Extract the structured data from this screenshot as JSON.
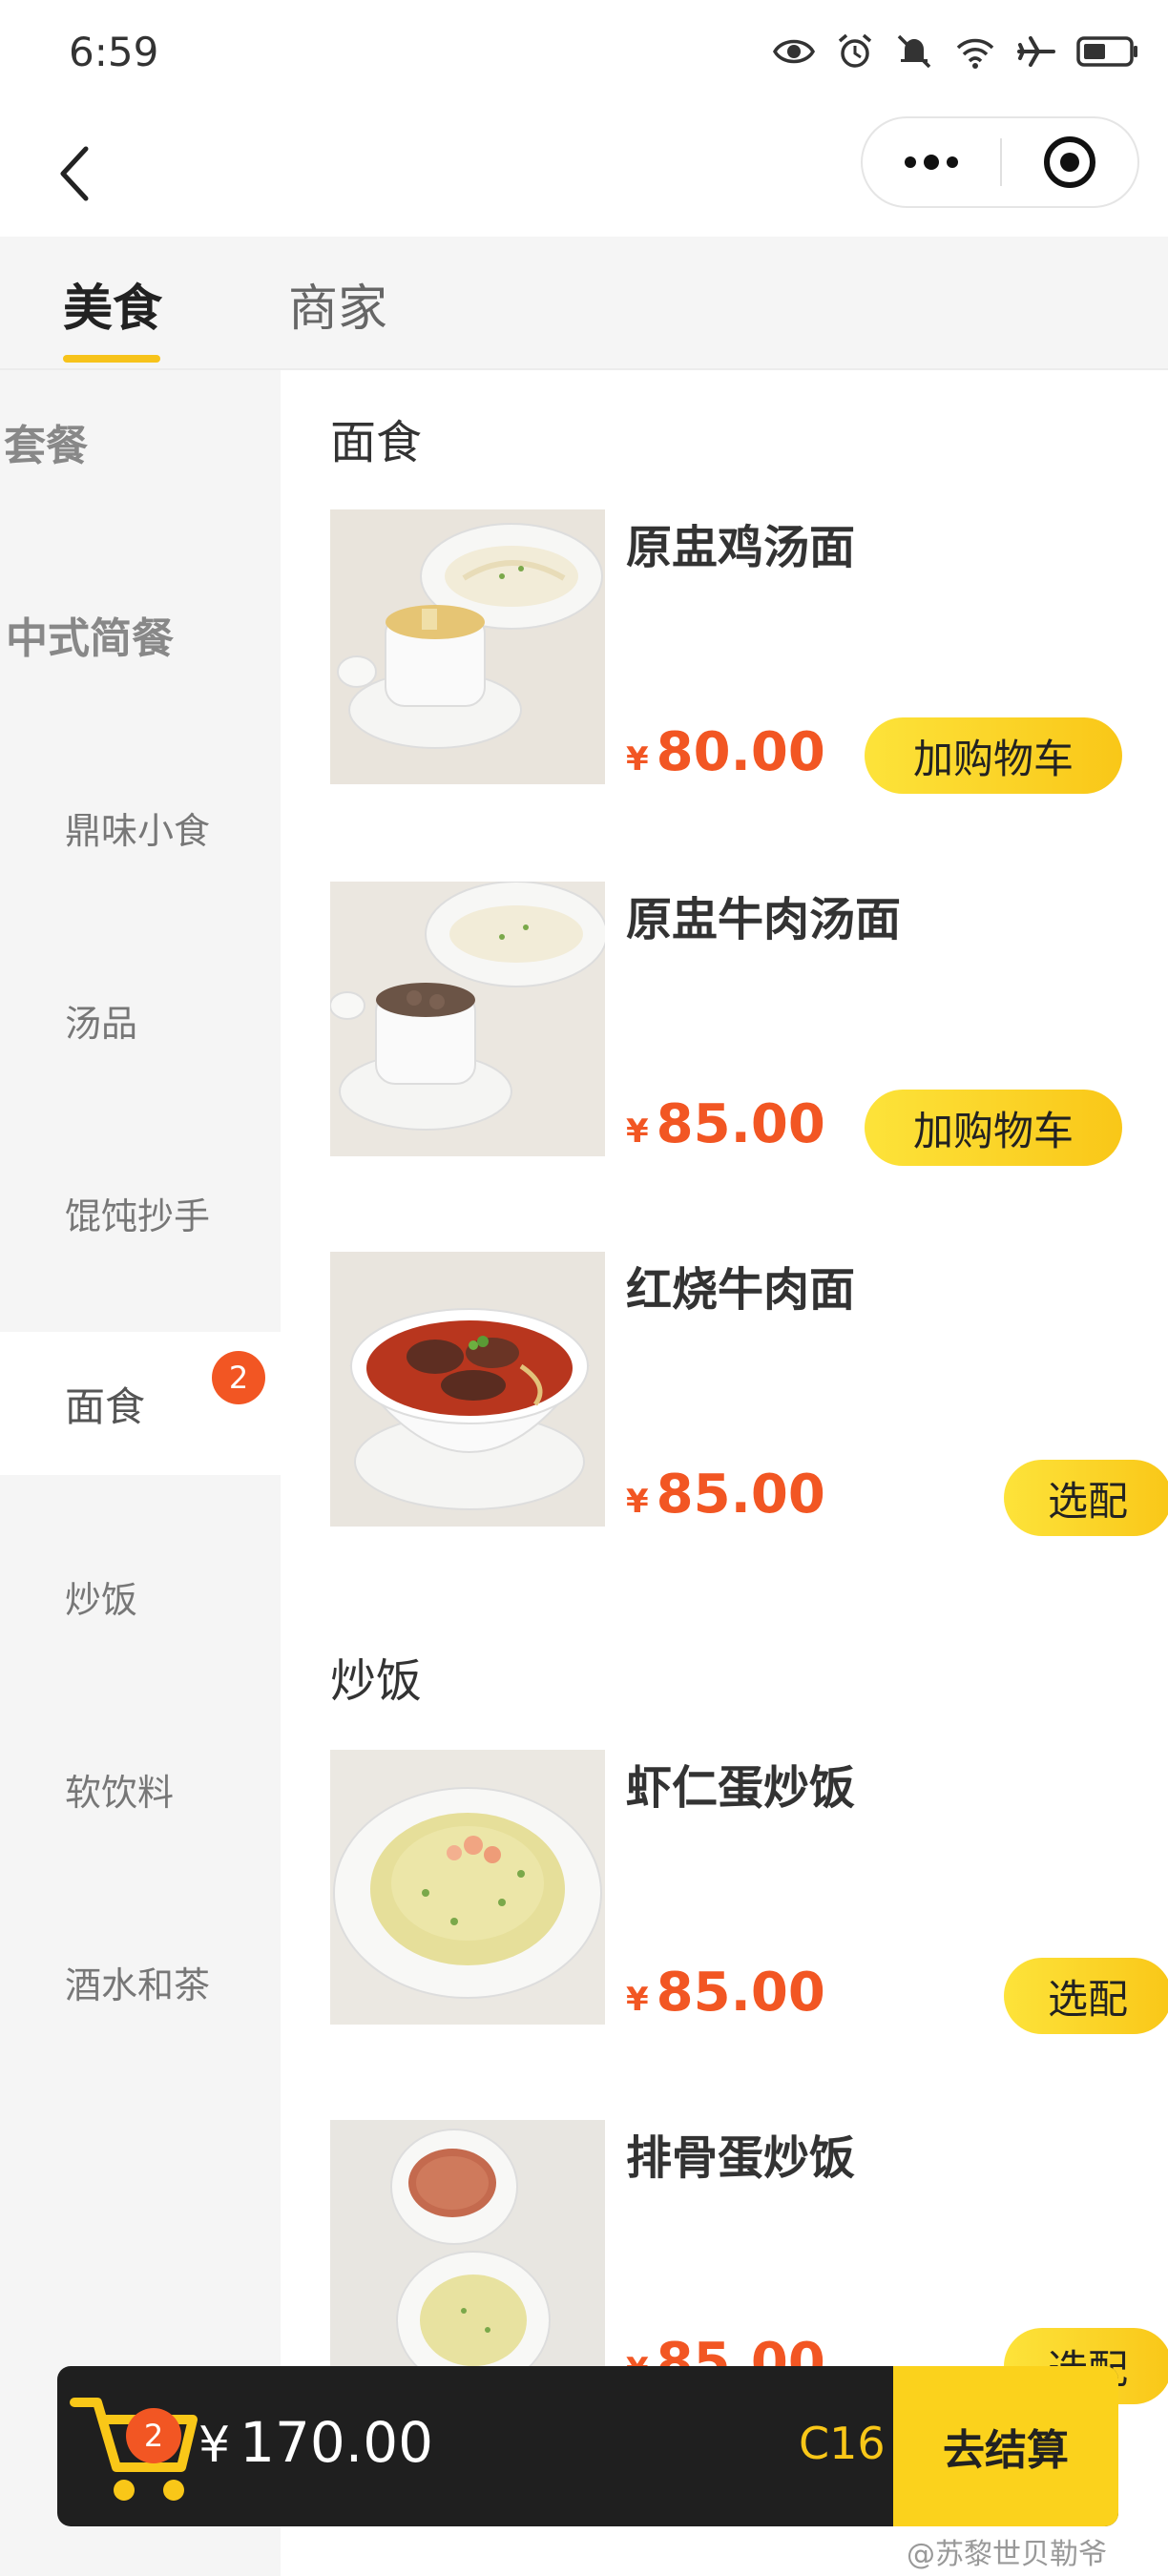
{
  "status_bar": {
    "time": "6:59",
    "icons": [
      "eye-icon",
      "alarm-icon",
      "bell-off-icon",
      "wifi-icon",
      "airplane-icon",
      "battery-icon"
    ]
  },
  "header": {
    "back_icon": "chevron-left-icon",
    "more_icon": "more-dots-icon",
    "close_icon": "target-icon"
  },
  "tabs": [
    {
      "label": "美食",
      "active": true
    },
    {
      "label": "商家",
      "active": false
    }
  ],
  "sidebar": {
    "items": [
      {
        "label": "套餐",
        "type": "group"
      },
      {
        "label": "中式简餐",
        "type": "group"
      },
      {
        "label": "鼎味小食",
        "type": "item"
      },
      {
        "label": "汤品",
        "type": "item"
      },
      {
        "label": "馄饨抄手",
        "type": "item"
      },
      {
        "label": "面食",
        "type": "item",
        "active": true,
        "badge": "2"
      },
      {
        "label": "炒饭",
        "type": "item"
      },
      {
        "label": "软饮料",
        "type": "item"
      },
      {
        "label": "酒水和茶",
        "type": "item"
      }
    ]
  },
  "sections": [
    {
      "title": "面食",
      "dishes": [
        {
          "name": "原盅鸡汤面",
          "currency": "¥",
          "price": "80.00",
          "button": "加购物车",
          "image": "chicken-soup-noodle-image"
        },
        {
          "name": "原盅牛肉汤面",
          "currency": "¥",
          "price": "85.00",
          "button": "加购物车",
          "image": "beef-soup-noodle-image"
        },
        {
          "name": "红烧牛肉面",
          "currency": "¥",
          "price": "85.00",
          "button": "选配",
          "image": "braised-beef-noodle-image"
        }
      ]
    },
    {
      "title": "炒饭",
      "dishes": [
        {
          "name": "虾仁蛋炒饭",
          "currency": "¥",
          "price": "85.00",
          "button": "选配",
          "image": "shrimp-fried-rice-image"
        },
        {
          "name": "排骨蛋炒饭",
          "currency": "¥",
          "price": "85.00",
          "button": "选配",
          "image": "pork-chop-fried-rice-image"
        }
      ]
    }
  ],
  "cart": {
    "badge": "2",
    "currency": "¥",
    "total": "170.00",
    "table": "C16",
    "checkout_label": "去结算"
  },
  "watermark": "@苏黎世贝勒爷",
  "colors": {
    "accent_yellow": "#f9c718",
    "price_orange": "#f25623",
    "sidebar_bg": "#f5f5f5",
    "cart_bg": "#1f1f1f"
  }
}
